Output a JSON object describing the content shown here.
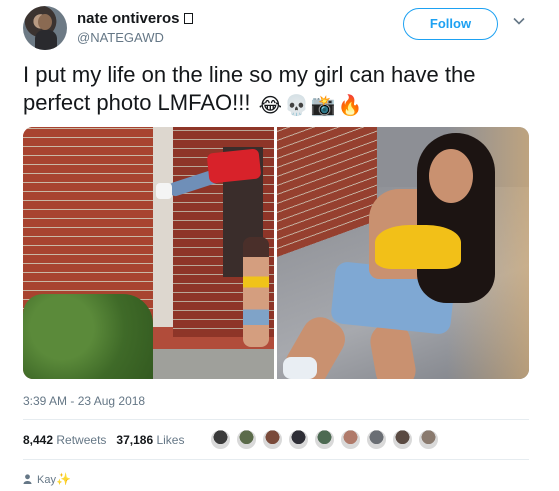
{
  "user": {
    "display_name": "nate ontiveros",
    "handle": "@NATEGAWD"
  },
  "follow_button": {
    "label": "Follow"
  },
  "tweet": {
    "text": "I put my life on the line so my girl can have the perfect photo LMFAO!!!",
    "emojis": [
      "😂",
      "💀",
      "📸",
      "🔥"
    ]
  },
  "timestamp": "3:39 AM - 23 Aug 2018",
  "stats": {
    "retweets_count": "8,442",
    "retweets_label": "Retweets",
    "likes_count": "37,186",
    "likes_label": "Likes"
  },
  "liker_avatar_colors": [
    "#3a3a3a",
    "#5b6b4a",
    "#7a4a3a",
    "#2e2e36",
    "#4d6a52",
    "#b07a6a",
    "#6a6e74",
    "#5a4a42",
    "#8a7a6e"
  ],
  "footer": {
    "text": "Kay",
    "sparkle": "✨"
  },
  "colors": {
    "accent": "#1da1f2",
    "muted": "#657786",
    "text": "#14171a"
  }
}
